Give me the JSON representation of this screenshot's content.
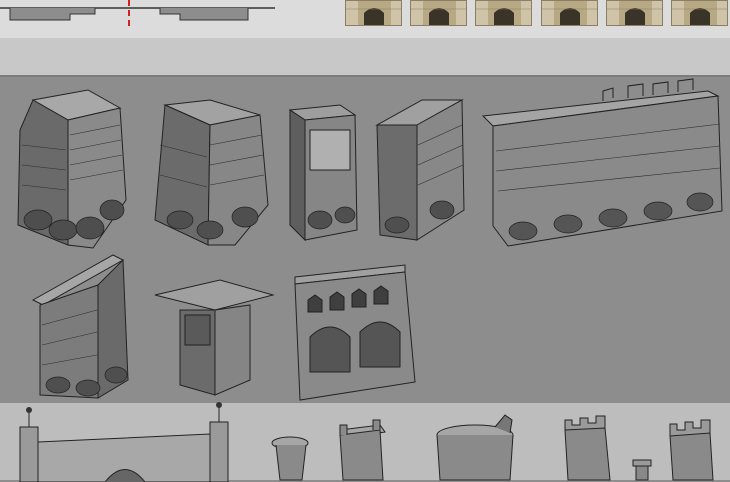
{
  "colors": {
    "canvas": "#8e8e8e",
    "top_band": "#dcdcdc",
    "divider_red": "#d22020",
    "thumbnail_stone": "#b8a985"
  },
  "thumbnails": [
    {
      "icon": "arch-gate-thumb"
    },
    {
      "icon": "arch-gate-thumb"
    },
    {
      "icon": "arch-gate-thumb"
    },
    {
      "icon": "arch-gate-thumb"
    },
    {
      "icon": "arch-gate-thumb"
    },
    {
      "icon": "arch-gate-thumb"
    }
  ],
  "sketches": {
    "row1": [
      "corner-tower",
      "corner-tower-cutaway",
      "wall-end-pillar",
      "l-wall-segment",
      "long-crenellated-wall"
    ],
    "row2": [
      "corner-wall-gabled",
      "corner-pillar-inner",
      "arched-gatehouse"
    ],
    "row3": [
      "bridge-with-lanterns",
      "small-turret",
      "square-turret",
      "round-tower",
      "tall-crenellated-tower",
      "small-crenellated-tower"
    ]
  }
}
